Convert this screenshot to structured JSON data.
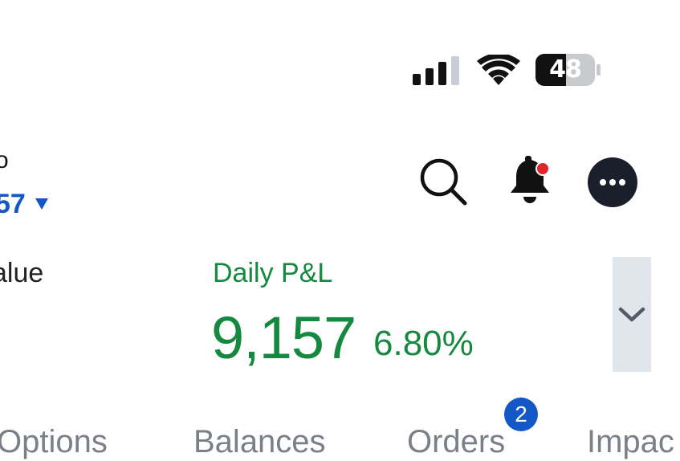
{
  "status_bar": {
    "battery_level": "48",
    "signal_icon": "cellular-signal-icon",
    "wifi_icon": "wifi-icon"
  },
  "account": {
    "prefix": "o",
    "value": "57"
  },
  "header_icons": {
    "search": "search-icon",
    "notifications": "bell-icon",
    "more": "more-icon"
  },
  "summary": {
    "net_label": "alue",
    "daily_pnl_label": "Daily P&L",
    "daily_pnl_value": "9,157",
    "daily_pnl_percent": "6.80%"
  },
  "tabs": [
    {
      "label": "Options"
    },
    {
      "label": "Balances"
    },
    {
      "label": "Orders",
      "badge": "2"
    },
    {
      "label": "Impac"
    }
  ],
  "colors": {
    "positive": "#14893f",
    "accent": "#1457c7",
    "notification_dot": "#e0242c"
  }
}
